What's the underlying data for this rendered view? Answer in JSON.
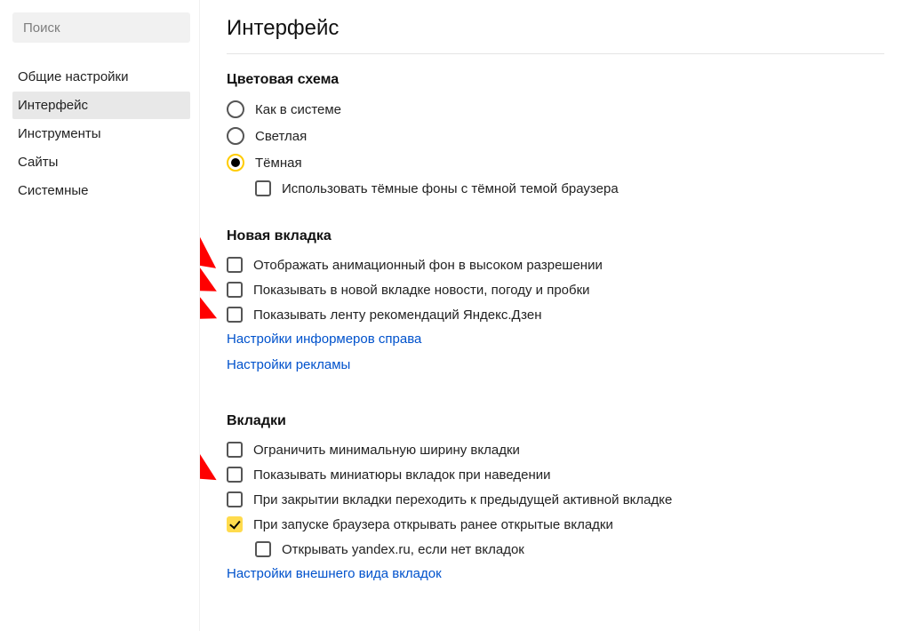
{
  "search": {
    "placeholder": "Поиск"
  },
  "sidebar": {
    "items": [
      {
        "label": "Общие настройки"
      },
      {
        "label": "Интерфейс"
      },
      {
        "label": "Инструменты"
      },
      {
        "label": "Сайты"
      },
      {
        "label": "Системные"
      }
    ]
  },
  "page": {
    "title": "Интерфейс"
  },
  "sections": {
    "color_scheme": {
      "title": "Цветовая схема",
      "options": {
        "system": "Как в системе",
        "light": "Светлая",
        "dark": "Тёмная",
        "dark_bg_sub": "Использовать тёмные фоны с тёмной темой браузера"
      }
    },
    "new_tab": {
      "title": "Новая вкладка",
      "options": {
        "anim_bg": "Отображать анимационный фон в высоком разрешении",
        "show_news": "Показывать в новой вкладке новости, погоду и пробки",
        "show_zen": "Показывать ленту рекомендаций Яндекс.Дзен"
      },
      "links": {
        "informers": "Настройки информеров справа",
        "ads": "Настройки рекламы"
      }
    },
    "tabs": {
      "title": "Вкладки",
      "options": {
        "min_width": "Ограничить минимальную ширину вкладки",
        "thumbnails": "Показывать миниатюры вкладок при наведении",
        "prev_active": "При закрытии вкладки переходить к предыдущей активной вкладке",
        "open_prev": "При запуске браузера открывать ранее открытые вкладки",
        "open_yandex": "Открывать yandex.ru, если нет вкладок"
      },
      "links": {
        "appearance": "Настройки внешнего вида вкладок"
      }
    }
  }
}
